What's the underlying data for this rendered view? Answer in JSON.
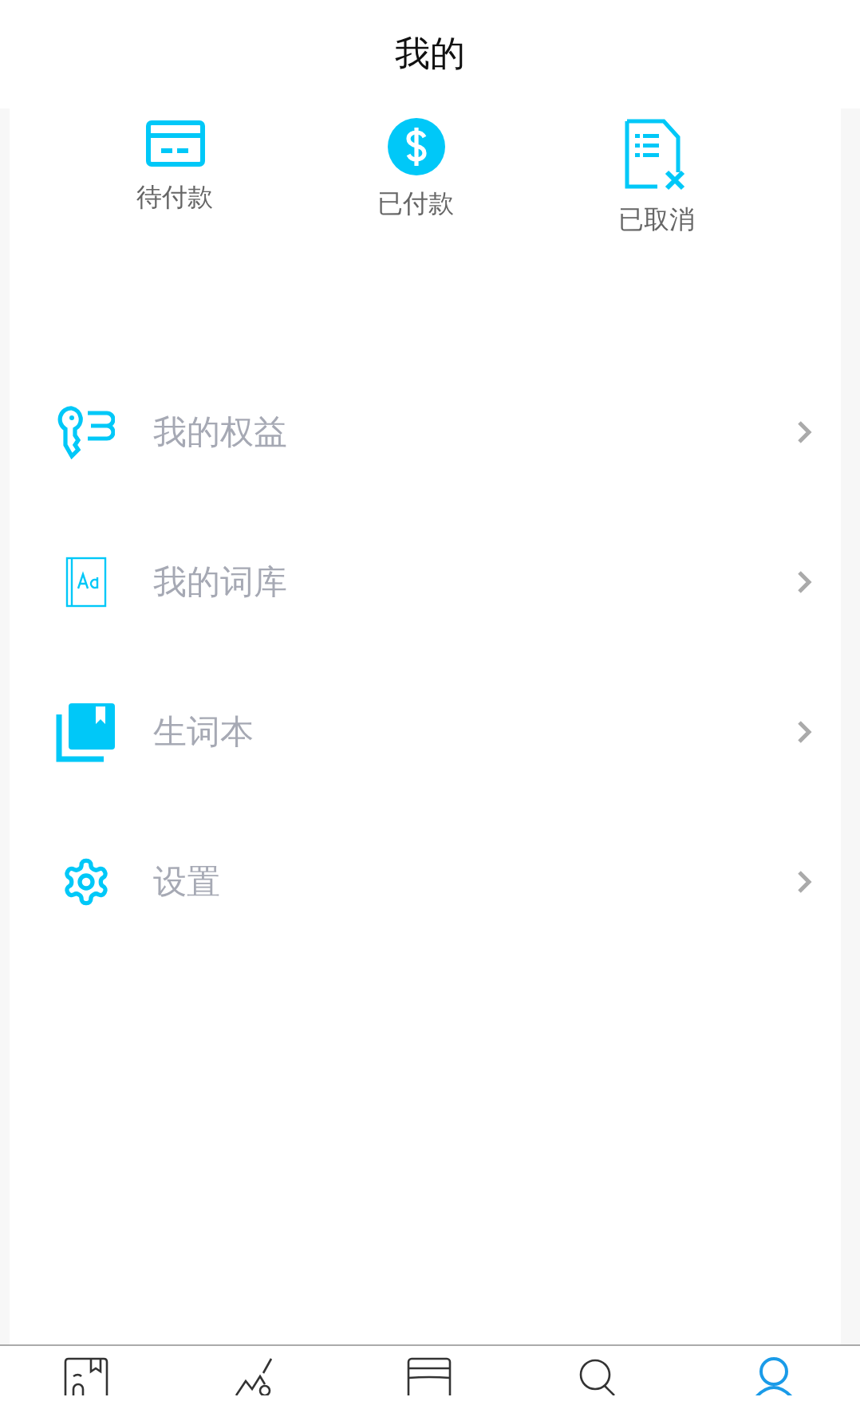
{
  "header": {
    "title": "我的"
  },
  "orders": [
    {
      "kind": "card",
      "label": "待付款"
    },
    {
      "kind": "dollar",
      "label": "已付款"
    },
    {
      "kind": "cancel",
      "label": "已取消"
    }
  ],
  "menu": [
    {
      "kind": "key",
      "label": "我的权益"
    },
    {
      "kind": "dictionary",
      "label": "我的词库"
    },
    {
      "kind": "bookmark",
      "label": "生词本"
    },
    {
      "kind": "gear",
      "label": "设置"
    }
  ],
  "tabs": [
    {
      "kind": "book",
      "selected": false
    },
    {
      "kind": "chart",
      "selected": false
    },
    {
      "kind": "cards",
      "selected": false
    },
    {
      "kind": "search",
      "selected": false
    },
    {
      "kind": "person",
      "selected": true
    }
  ]
}
